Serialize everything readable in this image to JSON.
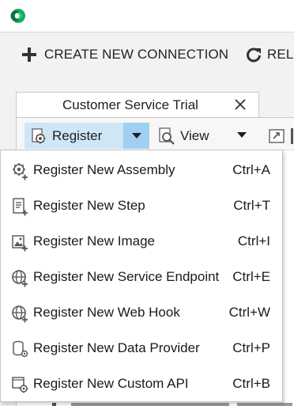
{
  "toolbar": {
    "create_label": "CREATE NEW CONNECTION",
    "reload_label": "RELO"
  },
  "tab": {
    "title": "Customer Service Trial"
  },
  "panel_toolbar": {
    "register_label": "Register",
    "view_label": "View"
  },
  "menu": {
    "items": [
      {
        "label": "Register New Assembly",
        "shortcut": "Ctrl+A",
        "icon": "assembly-gear-icon"
      },
      {
        "label": "Register New Step",
        "shortcut": "Ctrl+T",
        "icon": "step-document-icon"
      },
      {
        "label": "Register New Image",
        "shortcut": "Ctrl+I",
        "icon": "image-icon"
      },
      {
        "label": "Register New Service Endpoint",
        "shortcut": "Ctrl+E",
        "icon": "service-endpoint-globe-icon"
      },
      {
        "label": "Register New Web Hook",
        "shortcut": "Ctrl+W",
        "icon": "web-hook-globe-icon"
      },
      {
        "label": "Register New Data Provider",
        "shortcut": "Ctrl+P",
        "icon": "data-provider-icon"
      },
      {
        "label": "Register New Custom API",
        "shortcut": "Ctrl+B",
        "icon": "custom-api-icon"
      }
    ]
  },
  "colors": {
    "register_button_bg": "#cfe6f7",
    "register_dropdown_bg": "#9fd0f2",
    "logo_green": "#1faa5a"
  }
}
